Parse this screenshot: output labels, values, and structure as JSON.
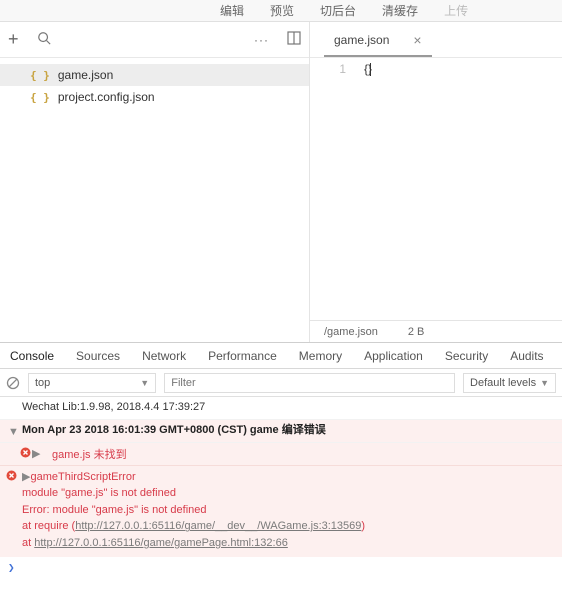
{
  "menu": {
    "compile": "编辑",
    "preview": "预览",
    "background": "切后台",
    "clearCache": "清缓存",
    "upload": "上传"
  },
  "files": [
    {
      "name": "game.json",
      "icon": "{ }"
    },
    {
      "name": "project.config.json",
      "icon": "{ }"
    }
  ],
  "tab": {
    "name": "game.json",
    "close": "×"
  },
  "editor": {
    "lineNum": "1",
    "content": "{}"
  },
  "status": {
    "path": "/game.json",
    "size": "2 B"
  },
  "devtabs": [
    "Console",
    "Sources",
    "Network",
    "Performance",
    "Memory",
    "Application",
    "Security",
    "Audits"
  ],
  "sub": {
    "context": "top",
    "filterPlaceholder": "Filter",
    "levels": "Default levels"
  },
  "log": {
    "lib": "Wechat Lib:1.9.98, 2018.4.4 17:39:27",
    "group": "Mon Apr 23 2018 16:01:39 GMT+0800 (CST) game 编译错误",
    "gjsNotFound": "game.js 未找到",
    "gts": "gameThirdScriptError",
    "l1": "module \"game.js\" is not defined",
    "l2": "Error: module \"game.js\" is not defined",
    "at1a": "    at require (",
    "url1": "http://127.0.0.1:65116/game/__dev__/WAGame.js:3:13569",
    "at1b": ")",
    "at2a": "    at ",
    "url2": "http://127.0.0.1:65116/game/gamePage.html:132:66"
  }
}
